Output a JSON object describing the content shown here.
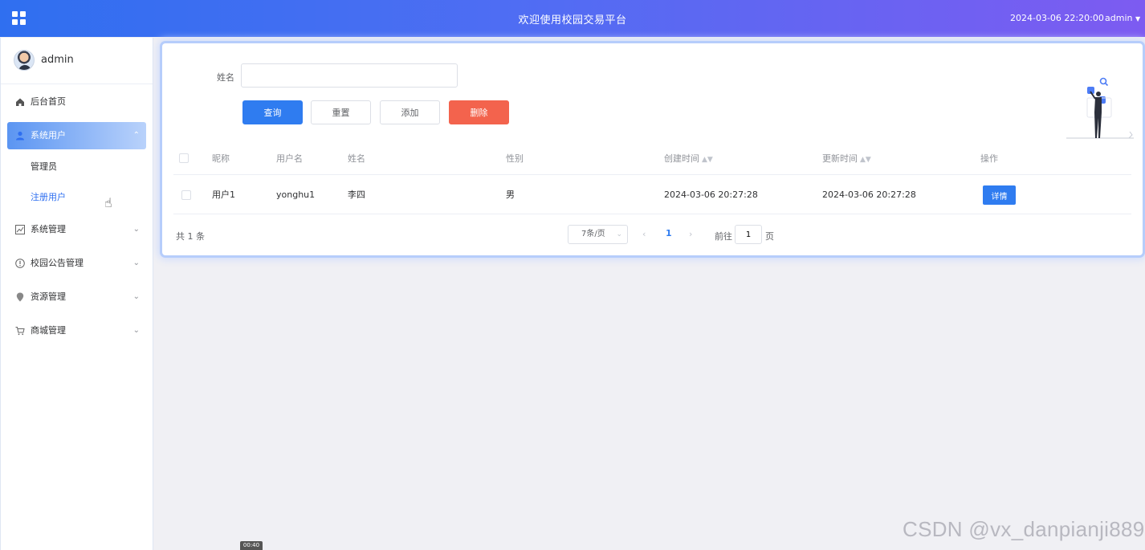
{
  "header": {
    "title": "欢迎使用校园交易平台",
    "datetime": "2024-03-06 22:20:00",
    "user_label": "admin",
    "colors": {
      "gradient_start": "#2f6ff0",
      "gradient_end": "#7d5bf1"
    }
  },
  "sidebar": {
    "user_name": "admin",
    "items": [
      {
        "label": "后台首页",
        "icon": "home-icon"
      },
      {
        "label": "系统用户",
        "icon": "user-icon",
        "expanded": true,
        "children": [
          {
            "label": "管理员"
          },
          {
            "label": "注册用户",
            "current": true
          }
        ]
      },
      {
        "label": "系统管理",
        "icon": "chart-icon"
      },
      {
        "label": "校园公告管理",
        "icon": "info-circle-icon"
      },
      {
        "label": "资源管理",
        "icon": "location-icon"
      },
      {
        "label": "商城管理",
        "icon": "cart-icon"
      }
    ]
  },
  "search": {
    "label": "姓名",
    "value": "",
    "placeholder": ""
  },
  "buttons": {
    "query": "查询",
    "reset": "重置",
    "add": "添加",
    "delete": "删除"
  },
  "table": {
    "headers": [
      "昵称",
      "用户名",
      "姓名",
      "性别",
      "创建时间",
      "更新时间",
      "操作"
    ],
    "rows": [
      {
        "nickname": "用户1",
        "username": "yonghu1",
        "name": "李四",
        "gender": "男",
        "created": "2024-03-06 20:27:28",
        "updated": "2024-03-06 20:27:28",
        "action": "详情"
      }
    ]
  },
  "pagination": {
    "total_text": "共 1 条",
    "page_size": "7条/页",
    "current_page": "1",
    "goto_label": "前往",
    "goto_value": "1",
    "goto_suffix": "页"
  },
  "overlay": {
    "watermark": "CSDN @vx_danpianji889",
    "timecode": "00:40"
  },
  "colors": {
    "primary": "#2f7cf0",
    "danger": "#f3634d",
    "active_menu": "#5b95f2"
  }
}
